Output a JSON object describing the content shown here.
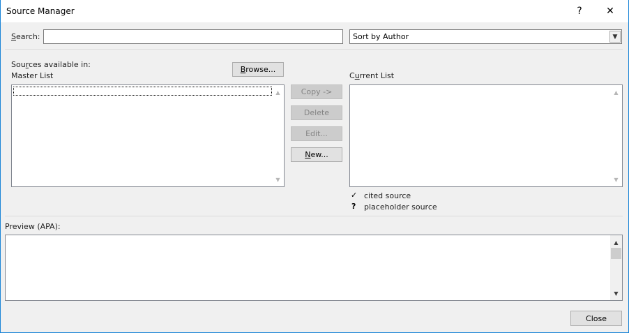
{
  "window": {
    "title": "Source Manager",
    "help_glyph": "?",
    "close_glyph": "✕"
  },
  "search": {
    "label_pre": "",
    "label_underlined": "S",
    "label_post": "earch:",
    "value": "",
    "placeholder": ""
  },
  "sort": {
    "selected": "Sort by Author"
  },
  "sources_available": {
    "label_pre": "Sou",
    "label_underlined": "r",
    "label_post": "ces available in:",
    "list_name": "Master List"
  },
  "browse_button": {
    "label_pre": "",
    "label_underlined": "B",
    "label_post": "rowse..."
  },
  "current_list": {
    "label_pre": "C",
    "label_underlined": "u",
    "label_post": "rrent List"
  },
  "actions": {
    "copy": "Copy ->",
    "delete": "Delete",
    "edit": "Edit...",
    "new_pre": "",
    "new_underlined": "N",
    "new_post": "ew..."
  },
  "legend": {
    "cited_glyph": "✓",
    "cited_label": "cited source",
    "placeholder_glyph": "?",
    "placeholder_label": "placeholder source"
  },
  "preview": {
    "label": "Preview (APA):"
  },
  "footer": {
    "close_label": "Close"
  },
  "scroll_glyphs": {
    "up": "▲",
    "down": "▼",
    "select": "▼"
  }
}
